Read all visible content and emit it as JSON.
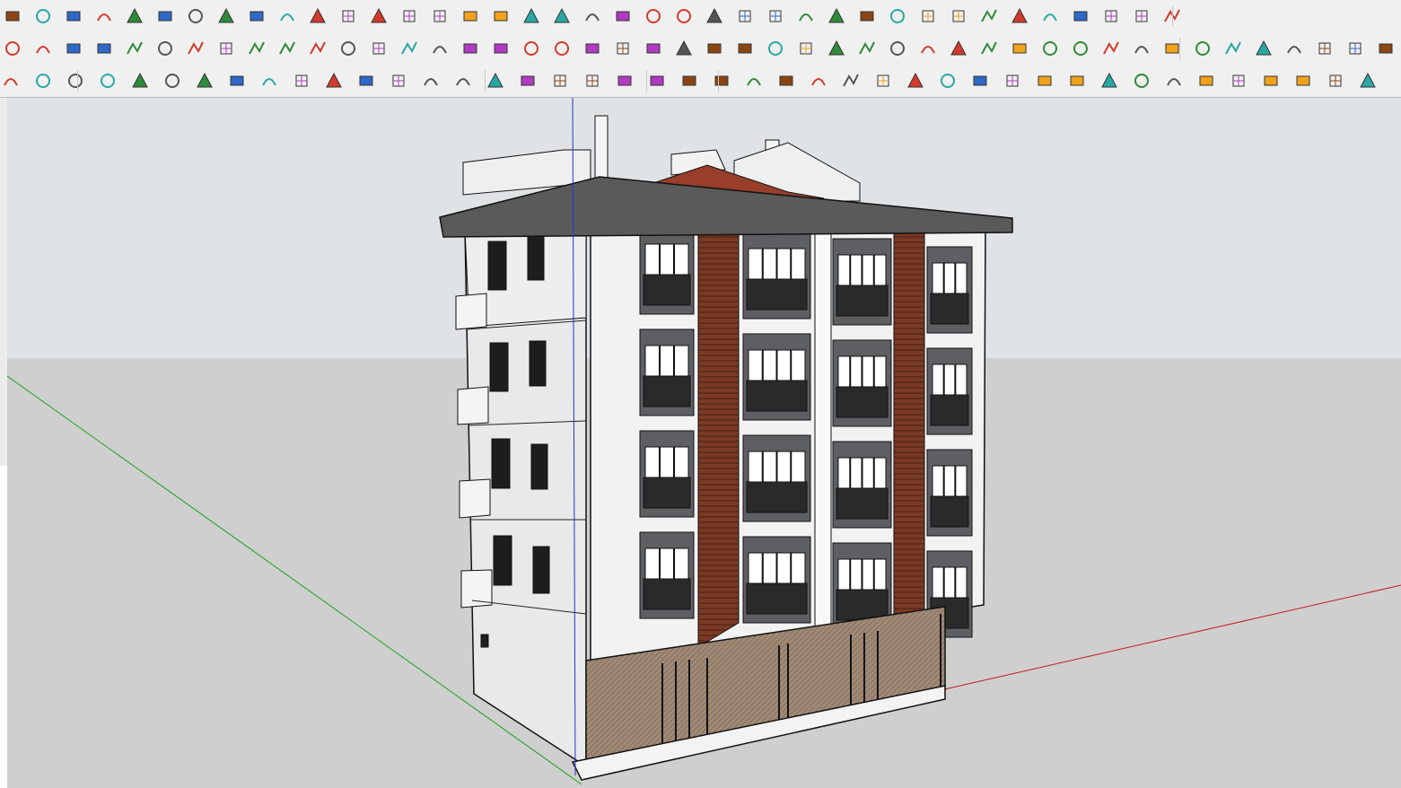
{
  "toolbars": {
    "row1": [
      "freehand-icon",
      "polyline-icon",
      "paint-bucket-icon",
      "scissors-icon",
      "rotate-icon",
      "push-pull-icon",
      "follow-me-icon",
      "box-icon",
      "sphere-icon",
      "cut-face-icon",
      "fillet-icon",
      "chamfer-icon",
      "line-icon",
      "curve-icon",
      "roof-icon",
      "shape-icon",
      "grid-icon",
      "array-icon",
      "hand-icon",
      "face-icon",
      "mirror-icon",
      "stairs-icon",
      "slope-icon",
      "lines-icon",
      "branch-icon",
      "scale-icon",
      "cup-icon",
      "terrain-icon",
      "wall-icon",
      "bell-icon",
      "ladder-icon",
      "hatch-icon",
      "stack-icon",
      "columns-icon",
      "pattern-icon",
      "fan-icon",
      "ribbon-icon",
      "fence-icon",
      "house-icon"
    ],
    "row2": [
      "tag-icon",
      "plane-blue-icon",
      "plane-yellow-icon",
      "plane-green-icon",
      "plane-red-icon",
      "plane-gray-icon",
      "rotate-orange-icon",
      "section-red-icon",
      "frame-icon",
      "flag-icon",
      "box-brown-icon",
      "link-icon",
      "corner-icon",
      "polyline-red-icon",
      "cross-red-icon",
      "cross-green-icon",
      "cross-blue-icon",
      "cone-green-icon",
      "cone-teal-icon",
      "warning-icon",
      "hook-icon",
      "snake-icon",
      "spiral-icon",
      "move-blue-icon",
      "cylinder-icon",
      "undo-red-icon",
      "cube-green-icon",
      "extrude-icon",
      "component-icon",
      "cube-multi-icon",
      "badge-icon",
      "grid-pack-icon",
      "panel-icon",
      "tile-orange-icon",
      "tile-yellow-icon",
      "tile-check-icon",
      "x-marks-icon",
      "arc-dotted-icon",
      "matrix-icon",
      "pencil-icon",
      "dimension-icon",
      "sweep-icon",
      "wedge-icon",
      "solid-icon",
      "shape-blue-icon",
      "arrow-curve-icon"
    ],
    "row3": [
      "arc-bracket-icon",
      "user-pin-icon",
      "triangle-mesh-icon",
      "bezier-icon",
      "zigzag-icon",
      "zigzag-red-icon",
      "wave-icon",
      "s-curve-icon",
      "arc-green-icon",
      "rectangle-icon",
      "circle-icon",
      "arc-icon",
      "spline-icon",
      "hook-curve-icon",
      "arc-small-icon",
      "arc-red-icon",
      "line-green-icon",
      "polygon-icon",
      "wrench-icon",
      "ellipse-icon",
      "sector-icon",
      "layer-green-icon",
      "star-green-icon",
      "select-icon",
      "scale-up-icon",
      "scale-down-icon",
      "align-icon",
      "align-add-icon",
      "align-remove-icon",
      "dash-icon",
      "dash-add-icon",
      "dash-remove-icon",
      "window-cross-icon",
      "window-grid-icon",
      "window-hatch-icon",
      "panel-blue-icon",
      "panel-blue2-icon",
      "panel-x-icon",
      "mesh-icon",
      "brick-icon",
      "dome-icon",
      "checker-icon",
      "copy-icon"
    ]
  },
  "viewport": {
    "sky_color": "#dfe3e6",
    "ground_color": "#cfcfcf",
    "axis_red": "#c41a1a",
    "axis_green": "#1ba11b",
    "axis_blue": "#2435c6",
    "cladding_color": "#7a3a24",
    "frame_color": "#5d5f62",
    "wall_color": "#f2f2f2"
  }
}
